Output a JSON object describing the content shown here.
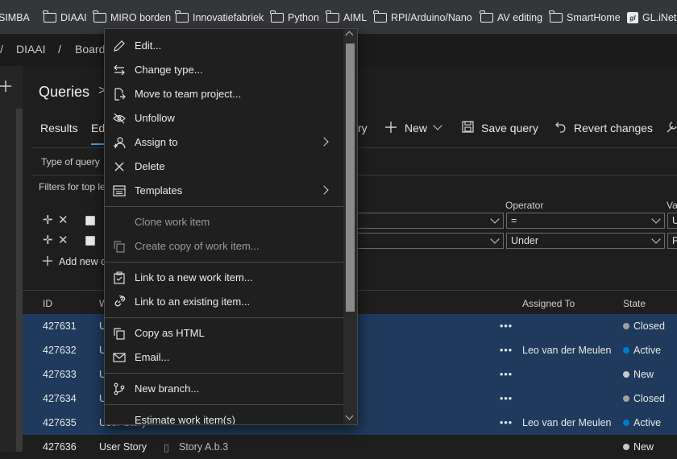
{
  "bookmarks": [
    {
      "label": "SIMBA",
      "icon": "none"
    },
    {
      "label": "DIAAI",
      "icon": "folder-icon"
    },
    {
      "label": "MIRO borden",
      "icon": "folder-icon"
    },
    {
      "label": "Innovatiefabriek",
      "icon": "folder-icon"
    },
    {
      "label": "Python",
      "icon": "folder-icon"
    },
    {
      "label": "AIML",
      "icon": "folder-icon"
    },
    {
      "label": "RPI/Arduino/Nano",
      "icon": "folder-icon"
    },
    {
      "label": "AV editing",
      "icon": "folder-icon"
    },
    {
      "label": "SmartHome",
      "icon": "folder-icon"
    },
    {
      "label": "GL.iNet A",
      "icon": "gl-logo"
    }
  ],
  "breadcrumb": {
    "sep1": "/",
    "project": "DIAAI",
    "sep2": "/",
    "section": "Board"
  },
  "page": {
    "title": "Queries",
    "title_chevron": ">"
  },
  "tabs": {
    "results": "Results",
    "editor": "Ed"
  },
  "toolbar": {
    "run_partial": "ry",
    "new": "New",
    "save_query": "Save query",
    "revert_changes": "Revert changes"
  },
  "filters": {
    "type_of_query": "Type of query",
    "filters_for": "Filters for top le",
    "operator_header": "Operator",
    "value_header": "Va",
    "row1": {
      "operator": "=",
      "value": "U"
    },
    "row2": {
      "operator": "Under",
      "value": "P"
    },
    "add_new": "Add new c"
  },
  "results": {
    "headers": {
      "id": "ID",
      "title_partial": "W",
      "assigned_to": "Assigned To",
      "state": "State"
    },
    "rows": [
      {
        "id": "427631",
        "type": "U",
        "title": "",
        "assigned": "",
        "state": "Closed",
        "state_color": "#a0a0a0",
        "more": "•••"
      },
      {
        "id": "427632",
        "type": "U",
        "title": "",
        "assigned": "Leo van der Meulen",
        "state": "Active",
        "state_color": "#007acc",
        "more": "•••"
      },
      {
        "id": "427633",
        "type": "U",
        "title": "",
        "assigned": "",
        "state": "New",
        "state_color": "#c8c8c8",
        "more": "•••"
      },
      {
        "id": "427634",
        "type": "U",
        "title": "",
        "assigned": "",
        "state": "Closed",
        "state_color": "#a0a0a0",
        "more": "•••"
      },
      {
        "id": "427635",
        "type": "User Story",
        "title": "",
        "assigned": "Leo van der Meulen",
        "state": "Active",
        "state_color": "#007acc",
        "more": "•••"
      },
      {
        "id": "427636",
        "type": "User Story",
        "title": "Story A.b.3",
        "assigned": "",
        "state": "New",
        "state_color": "#c8c8c8",
        "more": ""
      }
    ]
  },
  "context_menu": {
    "items": [
      {
        "label": "Edit...",
        "icon": "pencil-icon",
        "submenu": false,
        "disabled": false
      },
      {
        "label": "Change type...",
        "icon": "swap-arrows-icon",
        "submenu": false,
        "disabled": false
      },
      {
        "label": "Move to team project...",
        "icon": "move-to-icon",
        "submenu": false,
        "disabled": false
      },
      {
        "label": "Unfollow",
        "icon": "eye-slash-icon",
        "submenu": false,
        "disabled": false
      },
      {
        "label": "Assign to",
        "icon": "assign-person-icon",
        "submenu": true,
        "disabled": false
      },
      {
        "label": "Delete",
        "icon": "close-icon",
        "submenu": false,
        "disabled": false
      },
      {
        "label": "Templates",
        "icon": "template-icon",
        "submenu": true,
        "disabled": false
      },
      {
        "label": "Clone work item",
        "icon": "none",
        "submenu": false,
        "disabled": true
      },
      {
        "label": "Create copy of work item...",
        "icon": "copy-icon",
        "submenu": false,
        "disabled": true
      },
      {
        "label": "Link to a new work item...",
        "icon": "clipboard-link-icon",
        "submenu": false,
        "disabled": false
      },
      {
        "label": "Link to an existing item...",
        "icon": "link-icon",
        "submenu": false,
        "disabled": false
      },
      {
        "label": "Copy as HTML",
        "icon": "copy-icon",
        "submenu": false,
        "disabled": false
      },
      {
        "label": "Email...",
        "icon": "mail-icon",
        "submenu": false,
        "disabled": false
      },
      {
        "label": "New branch...",
        "icon": "branch-icon",
        "submenu": false,
        "disabled": false
      },
      {
        "label": "Estimate work item(s)",
        "icon": "none",
        "submenu": false,
        "disabled": false
      }
    ]
  }
}
